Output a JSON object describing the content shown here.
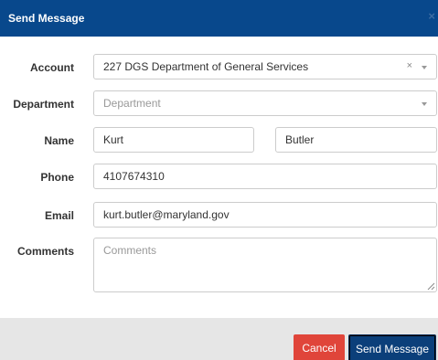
{
  "dialog": {
    "title": "Send Message",
    "close_icon": "close-x-icon"
  },
  "form": {
    "account": {
      "label": "Account",
      "value": "227 DGS Department of General Services",
      "clear_glyph": "×"
    },
    "department": {
      "label": "Department",
      "placeholder": "Department"
    },
    "name": {
      "label": "Name",
      "first": "Kurt",
      "last": "Butler"
    },
    "phone": {
      "label": "Phone",
      "value": "4107674310"
    },
    "email": {
      "label": "Email",
      "value": "kurt.butler@maryland.gov"
    },
    "comments": {
      "label": "Comments",
      "placeholder": "Comments"
    }
  },
  "footer": {
    "cancel_label": "Cancel",
    "send_label": "Send Message"
  },
  "colors": {
    "header": "#08488c",
    "cancel": "#e0453a",
    "send": "#0b3f7a",
    "footer": "#e6e6e6"
  }
}
